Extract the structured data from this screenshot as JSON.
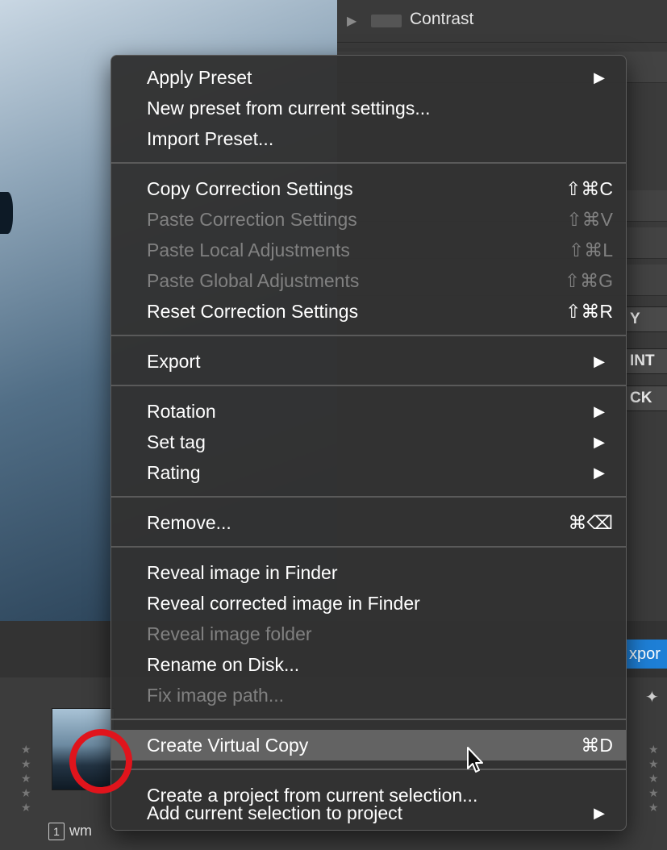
{
  "background": {
    "top_row_label": "Contrast",
    "side_buttons": [
      "Y",
      "INT",
      "CK"
    ],
    "export_tab_label": "xpor",
    "thumbnail": {
      "index_badge": "1",
      "filename": "wm"
    }
  },
  "menu": {
    "items": [
      {
        "label": "Apply Preset",
        "submenu": true
      },
      {
        "label": "New preset from current settings..."
      },
      {
        "label": "Import Preset..."
      },
      {
        "label": "Copy Correction Settings",
        "shortcut": "⇧⌘C"
      },
      {
        "label": "Paste Correction Settings",
        "shortcut": "⇧⌘V",
        "disabled": true
      },
      {
        "label": "Paste Local Adjustments",
        "shortcut": "⇧⌘L",
        "disabled": true
      },
      {
        "label": "Paste Global Adjustments",
        "shortcut": "⇧⌘G",
        "disabled": true
      },
      {
        "label": "Reset Correction Settings",
        "shortcut": "⇧⌘R"
      },
      {
        "label": "Export",
        "submenu": true
      },
      {
        "label": "Rotation",
        "submenu": true
      },
      {
        "label": "Set tag",
        "submenu": true
      },
      {
        "label": "Rating",
        "submenu": true
      },
      {
        "label": "Remove...",
        "shortcut": "⌘⌫"
      },
      {
        "label": "Reveal image in Finder"
      },
      {
        "label": "Reveal corrected image in Finder"
      },
      {
        "label": "Reveal image folder",
        "disabled": true
      },
      {
        "label": "Rename on Disk..."
      },
      {
        "label": "Fix image path...",
        "disabled": true
      },
      {
        "label": "Create Virtual Copy",
        "shortcut": "⌘D",
        "highlighted": true
      },
      {
        "label": "Create a project from current selection..."
      },
      {
        "label": "Add current selection to project",
        "submenu": true
      }
    ],
    "submenu_arrow": "▶"
  },
  "colors": {
    "menu_bg": "#323232",
    "highlight": "#636363",
    "disabled_text": "#818181",
    "annotation_circle": "#e0141c",
    "export_tab": "#1e7fd6"
  }
}
